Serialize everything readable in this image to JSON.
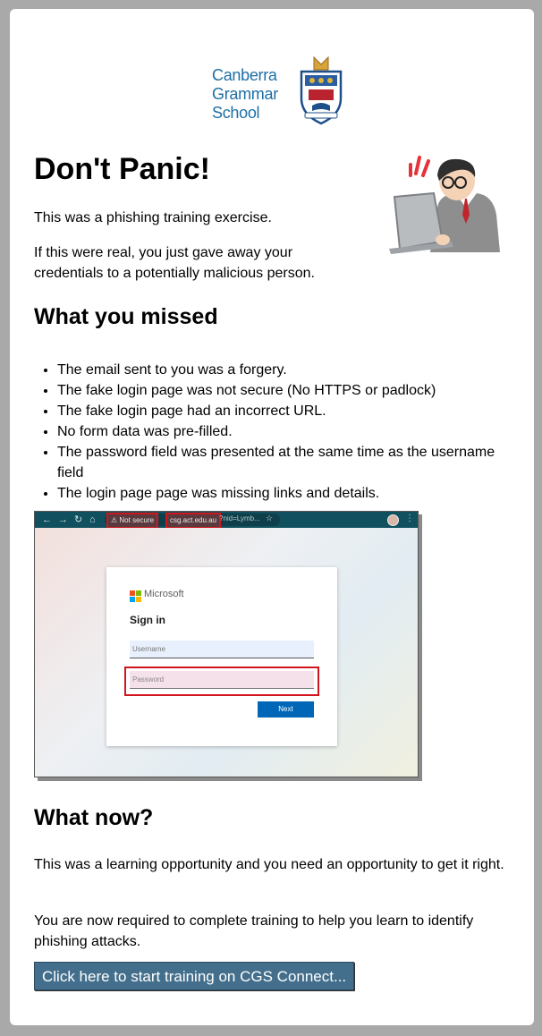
{
  "logo": {
    "line1": "Canberra",
    "line2": "Grammar",
    "line3": "School"
  },
  "heading": "Don't Panic!",
  "intro": [
    "This was a phishing training exercise.",
    "If this were real, you just gave away your credentials to a potentially malicious person."
  ],
  "missed": {
    "heading": "What you missed",
    "items": [
      "The email sent to you was a forgery.",
      "The fake login page was not secure (No HTTPS or padlock)",
      "The fake login page had an incorrect URL.",
      "No form data was pre-filled.",
      "The password field was presented at the same time as the username field",
      "The login page page was missing links and details."
    ]
  },
  "screenshot": {
    "not_secure": "Not secure",
    "domain": "csg.act.edu.au",
    "path": "?nid=Lymb...",
    "brand": "Microsoft",
    "signin": "Sign in",
    "username_placeholder": "Username",
    "password_placeholder": "Password",
    "next_label": "Next"
  },
  "now": {
    "heading": "What now?",
    "paragraphs": [
      "This was a learning opportunity and you need an opportunity to get it right.",
      "You are now required to complete training to help you learn to identify phishing attacks."
    ]
  },
  "button": "Click here to start training on CGS Connect...",
  "colors": {
    "page_bg": "#a9a9a9",
    "card_bg": "#ffffff",
    "brand_blue": "#1d6fa5",
    "button_bg": "#436f8c",
    "alert_red": "#d0161c"
  }
}
